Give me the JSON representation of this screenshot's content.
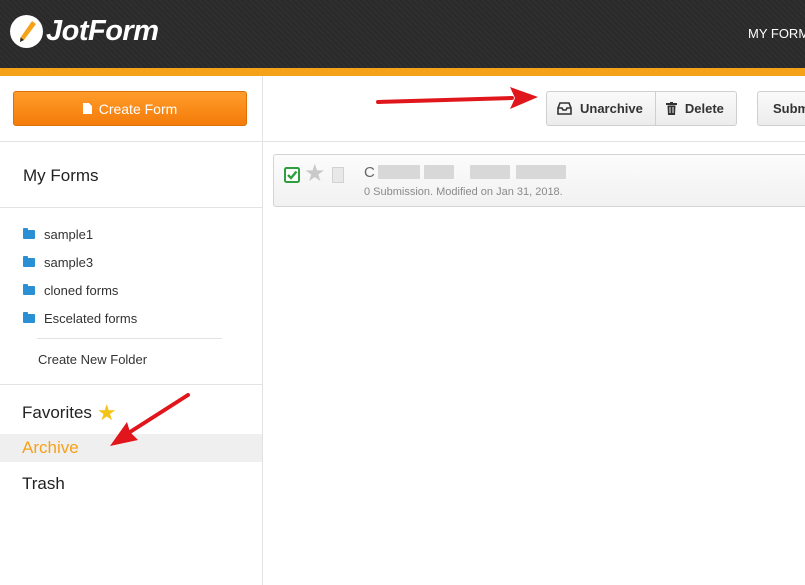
{
  "header": {
    "logo_text": "JotForm",
    "nav_label": "MY FORMS"
  },
  "sidebar": {
    "create_button_label": "Create Form",
    "my_forms_title": "My Forms",
    "folders": [
      {
        "label": "sample1",
        "icon": "folder-icon"
      },
      {
        "label": "sample3",
        "icon": "folder-icon"
      },
      {
        "label": "cloned forms",
        "icon": "folder-icon"
      },
      {
        "label": "Escelated forms",
        "icon": "folder-icon"
      }
    ],
    "create_folder_label": "Create New Folder",
    "favorites_label": "Favorites",
    "archive_label": "Archive",
    "trash_label": "Trash"
  },
  "toolbar": {
    "unarchive_label": "Unarchive",
    "delete_label": "Delete",
    "submissions_label": "Submissions"
  },
  "form_row": {
    "title_initial": "C",
    "meta": "0 Submission. Modified on Jan 31, 2018.",
    "checked": true,
    "starred": false
  },
  "colors": {
    "accent_orange": "#f6a11a",
    "header_dark": "#2b2b2b",
    "folder_blue": "#2b8fd6",
    "check_green": "#2e9e3e",
    "annotation_red": "#e0161c"
  }
}
